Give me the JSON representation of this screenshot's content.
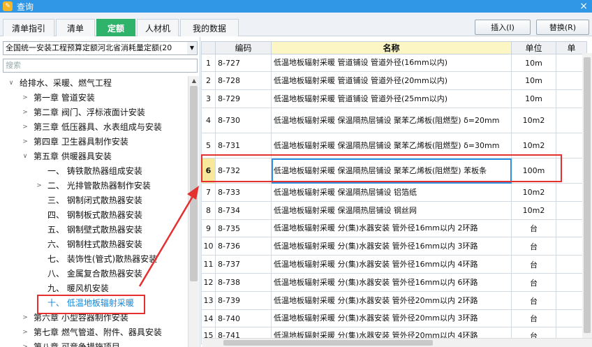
{
  "window": {
    "title": "查询",
    "close": "×"
  },
  "tabs": [
    {
      "label": "清单指引"
    },
    {
      "label": "清单"
    },
    {
      "label": "定额"
    },
    {
      "label": "人材机"
    },
    {
      "label": "我的数据"
    }
  ],
  "buttons": {
    "insert": "插入(I)",
    "replace": "替换(R)"
  },
  "left": {
    "select_value": "全国统一安装工程预算定额河北省消耗量定额(20",
    "search_placeholder": "搜索",
    "tree": [
      {
        "label": "给排水、采暖、燃气工程",
        "arrow": "∨"
      },
      {
        "label": "第一章  管道安装",
        "arrow": ">"
      },
      {
        "label": "第二章  阀门、浮标液面计安装",
        "arrow": ">"
      },
      {
        "label": "第三章  低压器具、水表组成与安装",
        "arrow": ">"
      },
      {
        "label": "第四章  卫生器具制作安装",
        "arrow": ">"
      },
      {
        "label": "第五章  供暖器具安装",
        "arrow": "∨"
      },
      {
        "label": "一、  铸铁散热器组成安装",
        "arrow": ""
      },
      {
        "label": "二、  光排管散热器制作安装",
        "arrow": ">"
      },
      {
        "label": "三、  钢制闭式散热器安装",
        "arrow": ""
      },
      {
        "label": "四、  钢制板式散热器安装",
        "arrow": ""
      },
      {
        "label": "五、  钢制壁式散热器安装",
        "arrow": ""
      },
      {
        "label": "六、  钢制柱式散热器安装",
        "arrow": ""
      },
      {
        "label": "七、  装饰性(管式)散热器安装",
        "arrow": ""
      },
      {
        "label": "八、  金属复合散热器安装",
        "arrow": ""
      },
      {
        "label": "九、  暖风机安装",
        "arrow": ""
      },
      {
        "label": "十、  低温地板辐射采暖",
        "arrow": ""
      },
      {
        "label": "第六章  小型容器制作安装",
        "arrow": ">"
      },
      {
        "label": "第七章  燃气管道、附件、器具安装",
        "arrow": ">"
      },
      {
        "label": "第八章  可竞争措施项目",
        "arrow": ">"
      }
    ]
  },
  "table": {
    "headers": {
      "no": "",
      "code": "编码",
      "name": "名称",
      "unit": "单位",
      "extra": "单"
    },
    "rows": [
      {
        "no": "1",
        "code": "8-727",
        "name": "低温地板辐射采暖 管道铺设 管道外径(16mm以内)",
        "unit": "10m"
      },
      {
        "no": "2",
        "code": "8-728",
        "name": "低温地板辐射采暖 管道铺设 管道外径(20mm以内)",
        "unit": "10m"
      },
      {
        "no": "3",
        "code": "8-729",
        "name": "低温地板辐射采暖 管道铺设 管道外径(25mm以内)",
        "unit": "10m"
      },
      {
        "no": "4",
        "code": "8-730",
        "name": "低温地板辐射采暖 保温隔热层铺设 聚苯乙烯板(阻燃型) δ=20mm",
        "unit": "10m2"
      },
      {
        "no": "5",
        "code": "8-731",
        "name": "低温地板辐射采暖 保温隔热层铺设 聚苯乙烯板(阻燃型) δ=30mm",
        "unit": "10m2"
      },
      {
        "no": "6",
        "code": "8-732",
        "name": "低温地板辐射采暖 保温隔热层铺设 聚苯乙烯板(阻燃型) 苯板条",
        "unit": "100m"
      },
      {
        "no": "7",
        "code": "8-733",
        "name": "低温地板辐射采暖 保温隔热层铺设 铝箔纸",
        "unit": "10m2"
      },
      {
        "no": "8",
        "code": "8-734",
        "name": "低温地板辐射采暖 保温隔热层铺设 钢丝网",
        "unit": "10m2"
      },
      {
        "no": "9",
        "code": "8-735",
        "name": "低温地板辐射采暖 分(集)水器安装 管外径16mm以内 2环路",
        "unit": "台"
      },
      {
        "no": "10",
        "code": "8-736",
        "name": "低温地板辐射采暖 分(集)水器安装 管外径16mm以内 3环路",
        "unit": "台"
      },
      {
        "no": "11",
        "code": "8-737",
        "name": "低温地板辐射采暖 分(集)水器安装 管外径16mm以内 4环路",
        "unit": "台"
      },
      {
        "no": "12",
        "code": "8-738",
        "name": "低温地板辐射采暖 分(集)水器安装 管外径16mm以内 6环路",
        "unit": "台"
      },
      {
        "no": "13",
        "code": "8-739",
        "name": "低温地板辐射采暖 分(集)水器安装 管外径20mm以内 2环路",
        "unit": "台"
      },
      {
        "no": "14",
        "code": "8-740",
        "name": "低温地板辐射采暖 分(集)水器安装 管外径20mm以内 3环路",
        "unit": "台"
      },
      {
        "no": "15",
        "code": "8-741",
        "name": "低温地板辐射采暖 分(集)水器安装 管外径20mm以内 4环路",
        "unit": "台"
      }
    ]
  },
  "colors": {
    "titlebar": "#2f97e6",
    "active_tab": "#2fb36b",
    "highlight": "#e53030",
    "selected_text": "#1487d8"
  }
}
